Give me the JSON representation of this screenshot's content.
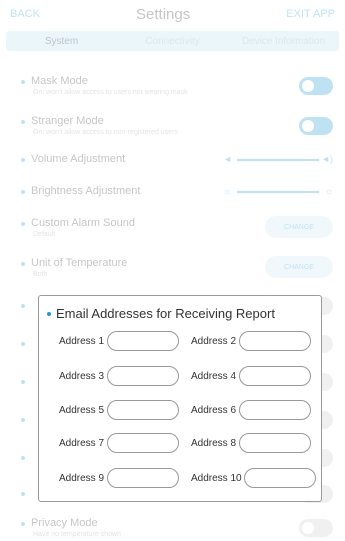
{
  "header": {
    "back_label": "BACK",
    "title": "Settings",
    "exit_label": "EXIT APP"
  },
  "tabs": [
    {
      "label": "System",
      "active": true
    },
    {
      "label": "Connectivity",
      "active": false
    },
    {
      "label": "Device Information",
      "active": false
    }
  ],
  "settings": {
    "mask_mode": {
      "label": "Mask Mode",
      "sub": "On: won't allow access to users not wearing mask",
      "enabled": true
    },
    "stranger_mode": {
      "label": "Stranger Mode",
      "sub": "On: won't allow access to non-registered users",
      "enabled": true
    },
    "volume": {
      "label": "Volume Adjustment"
    },
    "brightness": {
      "label": "Brightness Adjustment"
    },
    "alarm_sound": {
      "label": "Custom Alarm Sound",
      "sub": "Default",
      "button": "CHANGE"
    },
    "temperature_unit": {
      "label": "Unit of Temperature",
      "sub": "Both",
      "button": "CHANGE"
    },
    "privacy_mode": {
      "label": "Privacy Mode",
      "sub": "Have no temperature shown",
      "enabled": false
    }
  },
  "modal": {
    "title": "Email Addresses for Receiving Report",
    "addresses": [
      {
        "label": "Address 1",
        "value": ""
      },
      {
        "label": "Address 2",
        "value": ""
      },
      {
        "label": "Address 3",
        "value": ""
      },
      {
        "label": "Address 4",
        "value": ""
      },
      {
        "label": "Address 5",
        "value": ""
      },
      {
        "label": "Address 6",
        "value": ""
      },
      {
        "label": "Address 7",
        "value": ""
      },
      {
        "label": "Address 8",
        "value": ""
      },
      {
        "label": "Address 9",
        "value": ""
      },
      {
        "label": "Address 10",
        "value": ""
      }
    ]
  },
  "colors": {
    "accent": "#1e9bd7",
    "tab_bar": "#b9dff2",
    "modal_border": "#9a9a9a"
  }
}
